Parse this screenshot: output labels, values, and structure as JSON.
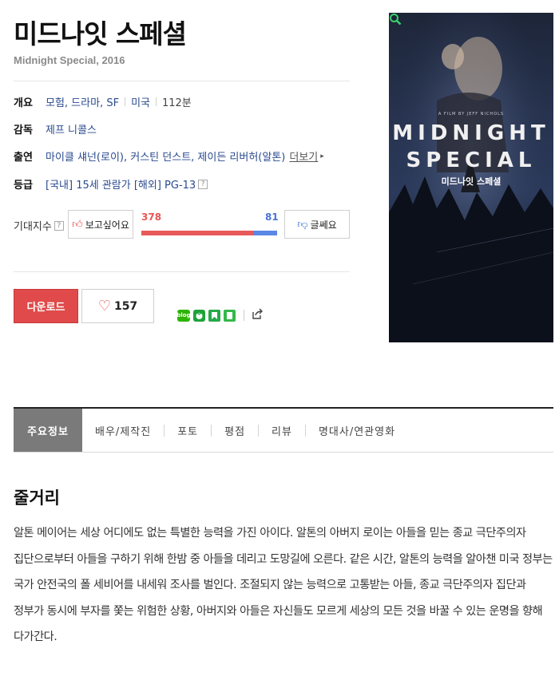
{
  "movie": {
    "title": "미드나잇 스페셜",
    "subtitle": "Midnight Special, 2016"
  },
  "info": {
    "overview": {
      "label": "개요",
      "genres": "모험, 드라마, SF",
      "country": "미국",
      "runtime": "112분"
    },
    "director": {
      "label": "감독",
      "name": "제프 니콜스"
    },
    "cast": {
      "label": "출연",
      "names": "마이클 섀넌(로이), 커스틴 던스트, 제이든 리버허(알톤)",
      "more_label": "더보기"
    },
    "rating": {
      "label": "등급",
      "text": "[국내] 15세 관람가 [해외] PG-13"
    }
  },
  "expectation": {
    "label": "기대지수",
    "want_label": "보고싶어요",
    "want_count": "378",
    "bad_label": "글쎄요",
    "bad_count": "81",
    "want_ratio": 0.8235
  },
  "actions": {
    "download_label": "다운로드",
    "like_count": "157"
  },
  "share": {
    "blog_text": "blog"
  },
  "poster": {
    "film_by": "A FILM BY JEFF NICHOLS",
    "title_line1": "MIDNIGHT",
    "title_line2": "SPECIAL",
    "title_kr": "미드나잇 스페셜"
  },
  "tabs": [
    {
      "label": "주요정보"
    },
    {
      "label": "배우/제작진"
    },
    {
      "label": "포토"
    },
    {
      "label": "평점"
    },
    {
      "label": "리뷰"
    },
    {
      "label": "명대사/연관영화"
    }
  ],
  "synopsis": {
    "title": "줄거리",
    "text": "알톤 메이어는 세상 어디에도 없는 특별한 능력을 가진 아이다. 알톤의 아버지 로이는 아들을 믿는 종교 극단주의자 집단으로부터 아들을 구하기 위해 한밤 중 아들을 데리고 도망길에 오른다. 같은 시간, 알톤의 능력을 알아챈 미국 정부는 국가 안전국의 폴 세비어를 내세워 조사를 벌인다. 조절되지 않는 능력으로 고통받는 아들, 종교 극단주의자 집단과 정부가 동시에 부자를 쫓는 위험한 상황, 아버지와 아들은 자신들도 모르게 세상의 모든 것을 바꿀 수 있는 운명을 향해 다가간다."
  },
  "colors": {
    "accent_red": "#e04a4a",
    "accent_blue": "#5b88e6",
    "link_blue": "#2a4a8f"
  }
}
